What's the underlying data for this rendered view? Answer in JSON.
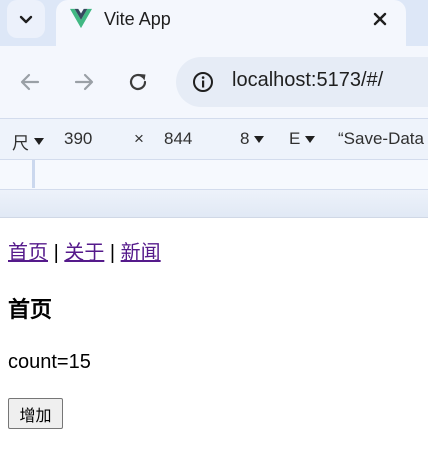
{
  "browser": {
    "tab": {
      "title": "Vite App"
    },
    "address_bar": {
      "url": "localhost:5173/#/"
    }
  },
  "devtools_toolbar": {
    "device_label": "尺",
    "width_value": "390",
    "dimension_separator": "×",
    "height_value": "844",
    "zoom_label": "8",
    "throttle_label": "E",
    "save_data_label": "“Save-Data"
  },
  "page": {
    "nav": {
      "home_link": "首页",
      "about_link": "关于",
      "news_link": "新闻",
      "separator": "|"
    },
    "heading": "首页",
    "count_text": "count=15",
    "add_button_label": "增加"
  },
  "colors": {
    "tab_strip": "#dde7f7",
    "active_tab": "#f4f7fd",
    "link_visited": "#551a8b",
    "vue_green": "#41b883",
    "vue_dark": "#35495e"
  }
}
